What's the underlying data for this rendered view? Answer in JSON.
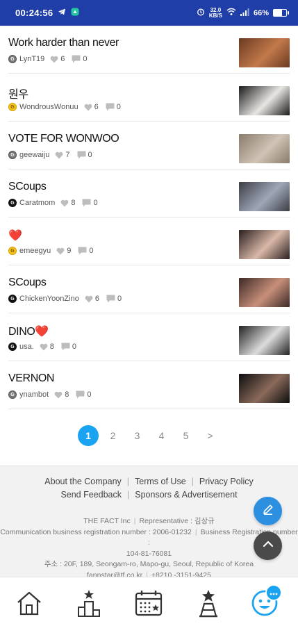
{
  "status_bar": {
    "time": "00:24:56",
    "net_speed_value": "32.0",
    "net_speed_unit": "KB/S",
    "battery": "66%",
    "battery_level": 0.66
  },
  "posts": [
    {
      "title": "Work harder than never",
      "grade": "gray",
      "author": "LynT19",
      "likes": "6",
      "comments": "0",
      "thumb": [
        "#6b3a22",
        "#c2794a"
      ]
    },
    {
      "title": "원우",
      "grade": "gold",
      "author": "WondrousWonuu",
      "likes": "6",
      "comments": "0",
      "thumb": [
        "#1a1a1a",
        "#e8e6e3"
      ]
    },
    {
      "title": "VOTE FOR WONWOO",
      "grade": "gray",
      "author": "geewaiju",
      "likes": "7",
      "comments": "0",
      "thumb": [
        "#8a7b6b",
        "#cfc4b6"
      ]
    },
    {
      "title": "SCoups",
      "grade": "black",
      "author": "Caratmom",
      "likes": "8",
      "comments": "0",
      "thumb": [
        "#3d3d44",
        "#9fa8b8"
      ]
    },
    {
      "title": "❤️",
      "grade": "gold",
      "author": "emeegyu",
      "likes": "9",
      "comments": "0",
      "thumb": [
        "#2a1f1f",
        "#d9b8a8"
      ]
    },
    {
      "title": "SCoups",
      "grade": "black",
      "author": "ChickenYoonZino",
      "likes": "6",
      "comments": "0",
      "thumb": [
        "#3b2a26",
        "#c88f7a"
      ]
    },
    {
      "title": "DINO❤️",
      "grade": "black",
      "author": "usa.",
      "likes": "8",
      "comments": "0",
      "thumb": [
        "#222222",
        "#dcdcdc"
      ]
    },
    {
      "title": "VERNON",
      "grade": "gray",
      "author": "ynambot",
      "likes": "8",
      "comments": "0",
      "thumb": [
        "#0d0d0d",
        "#8a6a5a"
      ]
    }
  ],
  "pagination": {
    "pages": [
      "1",
      "2",
      "3",
      "4",
      "5"
    ],
    "current": "1",
    "next": ">"
  },
  "footer": {
    "about": "About the Company",
    "terms": "Terms of Use",
    "privacy": "Privacy Policy",
    "feedback": "Send Feedback",
    "sponsors": "Sponsors & Advertisement",
    "company": "THE FACT Inc",
    "representative": "Representative : 김상규",
    "comm_reg": "Communication business registration number : 2006-01232",
    "biz_reg": "Business Registration number :",
    "biz_reg_num": "104-81-76081",
    "address": "주소 : 20F, 189, Seongam-ro, Mapo-gu, Seoul, Republic of Korea",
    "email": "fannstar@tf.co.kr",
    "phone": "+8210 -3151-9425"
  },
  "colors": {
    "accent": "#1aa3f0",
    "statusbar": "#1f3ea8",
    "write_fab": "#2d8fe0"
  },
  "bottom_nav": [
    "home-icon",
    "ranking-icon",
    "calendar-icon",
    "award-icon",
    "chat-face-icon"
  ]
}
